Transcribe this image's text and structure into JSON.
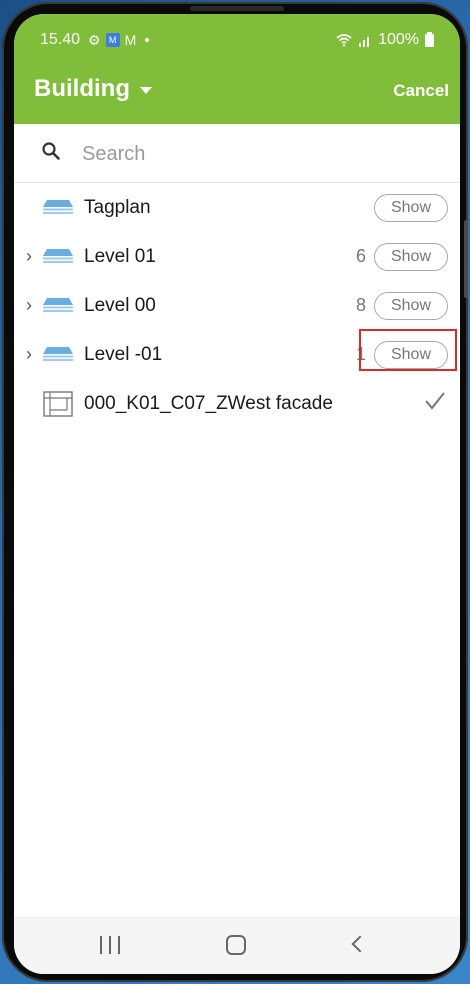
{
  "status_bar": {
    "time": "15.40",
    "battery": "100%",
    "icons": [
      "gear-icon",
      "app-notification-icon",
      "mail-icon",
      "dot-icon",
      "wifi-icon",
      "signal-icon",
      "battery-icon"
    ]
  },
  "app_bar": {
    "title": "Building",
    "cancel_label": "Cancel",
    "background": "#7fbd3a"
  },
  "search": {
    "placeholder": "Search",
    "value": ""
  },
  "list": {
    "items": [
      {
        "label": "Tagplan",
        "count": "",
        "action": "Show",
        "expandable": false,
        "icon": "level-stack-icon"
      },
      {
        "label": "Level 01",
        "count": "6",
        "action": "Show",
        "expandable": true,
        "icon": "level-stack-icon"
      },
      {
        "label": "Level 00",
        "count": "8",
        "action": "Show",
        "expandable": true,
        "icon": "level-stack-icon"
      },
      {
        "label": "Level -01",
        "count": "1",
        "action": "Show",
        "expandable": true,
        "icon": "level-stack-icon",
        "highlighted": true
      },
      {
        "label": "000_K01_C07_ZWest facade",
        "selected": true,
        "icon": "sheet-icon"
      }
    ]
  },
  "colors": {
    "accent_green": "#7fbd3a",
    "highlight_red": "#d62b2b",
    "icon_blue": "#6aaee0"
  }
}
